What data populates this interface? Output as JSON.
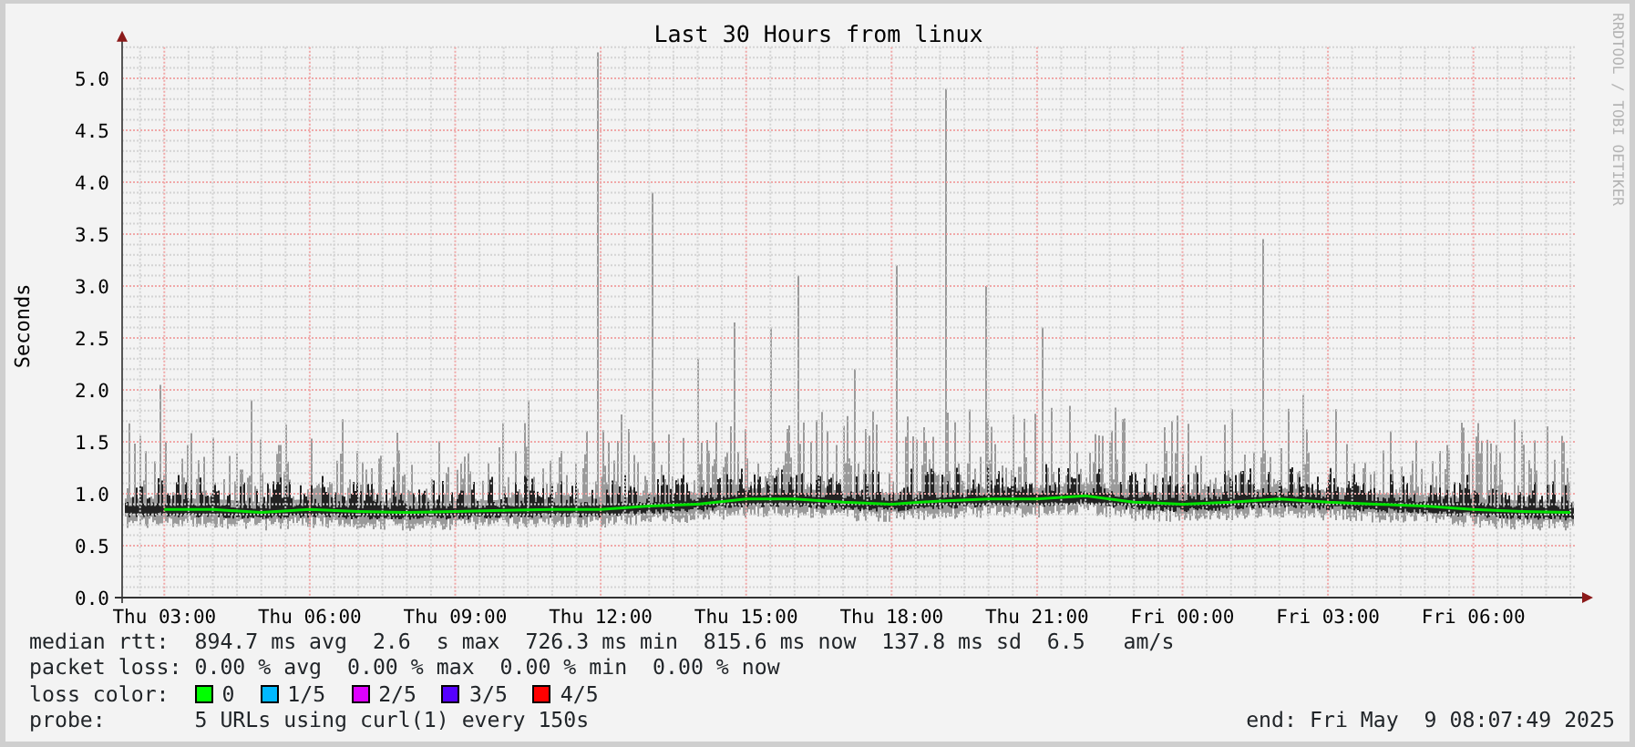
{
  "chart": {
    "credit": "RRDTOOL / TOBI OETIKER",
    "chart_data": {
      "type": "line",
      "title": "Last 30 Hours from linux",
      "ylabel": "Seconds",
      "categories": [
        "Thu 03:00",
        null,
        null,
        "Thu 06:00",
        null,
        null,
        "Thu 09:00",
        null,
        null,
        "Thu 12:00",
        null,
        null,
        "Thu 15:00",
        null,
        null,
        "Thu 18:00",
        null,
        null,
        "Thu 21:00",
        null,
        null,
        "Fri 00:00",
        null,
        null,
        "Fri 03:00",
        null,
        null,
        "Fri 06:00",
        null,
        null
      ],
      "series": [
        {
          "color": "#00e000",
          "values": [
            0.85,
            0.85,
            0.82,
            0.85,
            0.83,
            0.82,
            0.83,
            0.84,
            0.85,
            0.85,
            0.88,
            0.9,
            0.95,
            0.95,
            0.92,
            0.9,
            0.93,
            0.95,
            0.95,
            0.98,
            0.92,
            0.9,
            0.92,
            0.95,
            0.92,
            0.9,
            0.88,
            0.85,
            0.83,
            0.82
          ]
        }
      ],
      "ylim": [
        0,
        5.3
      ],
      "grid": true,
      "yticks": [
        {
          "value": 0,
          "label": "0.0"
        },
        {
          "value": 0.5,
          "label": "0.5"
        },
        {
          "value": 1,
          "label": "1.0"
        },
        {
          "value": 1.5,
          "label": "1.5"
        },
        {
          "value": 2,
          "label": "2.0"
        },
        {
          "value": 2.5,
          "label": "2.5"
        },
        {
          "value": 3,
          "label": "3.0"
        },
        {
          "value": 3.5,
          "label": "3.5"
        },
        {
          "value": 4,
          "label": "4.0"
        },
        {
          "value": 4.5,
          "label": "4.5"
        },
        {
          "value": 5,
          "label": "5.0"
        }
      ]
    }
  },
  "legend": {
    "rows": [
      {
        "kind": "stats",
        "label": "median rtt:",
        "text": "894.7 ms avg  2.6  s max  726.3 ms min  815.6 ms now  137.8 ms sd  6.5   am/s"
      },
      {
        "kind": "stats",
        "label": "packet loss:",
        "text": "0.00 % avg  0.00 % max  0.00 % min  0.00 % now"
      },
      {
        "kind": "swatches",
        "label": "loss color:",
        "items": [
          {
            "text": "0",
            "color": "#00ff00"
          },
          {
            "text": "1/5",
            "color": "#00b8ff"
          },
          {
            "text": "2/5",
            "color": "#dd00ff"
          },
          {
            "text": "3/5",
            "color": "#5500ff"
          },
          {
            "text": "4/5",
            "color": "#ff0000"
          }
        ]
      },
      {
        "kind": "stats",
        "label": "probe:",
        "text": "5 URLs using curl(1) every 150s",
        "note": "end: Fri May  9 08:07:49 2025"
      }
    ]
  }
}
